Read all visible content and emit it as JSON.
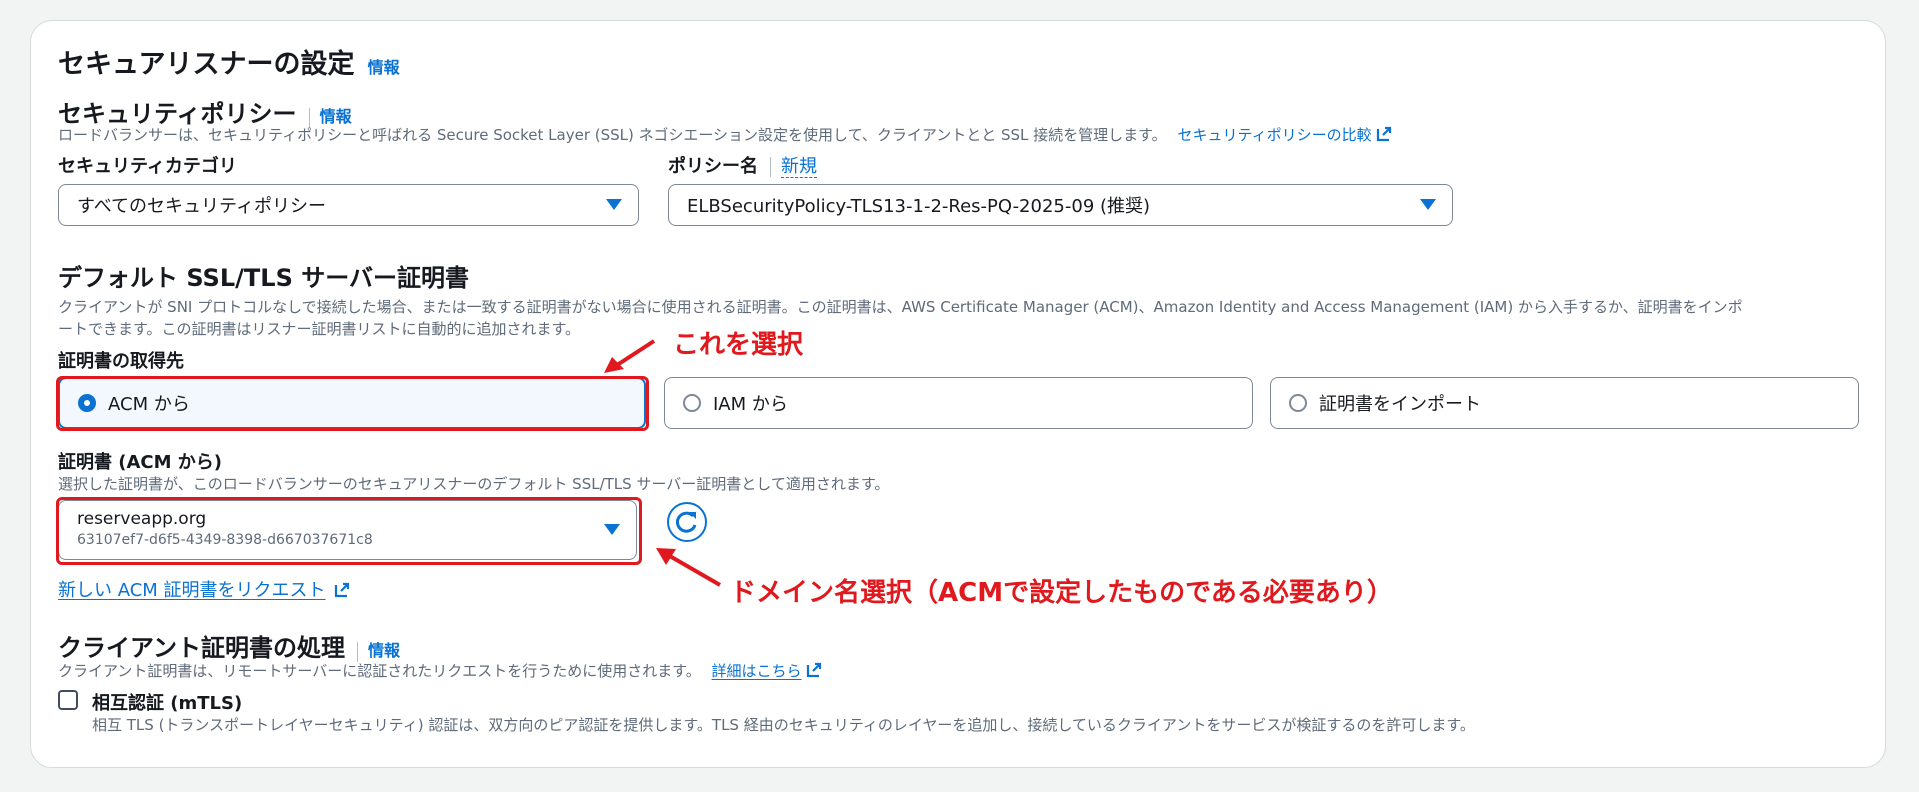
{
  "secure_listener": {
    "title": "セキュアリスナーの設定",
    "info": "情報"
  },
  "security_policy": {
    "title": "セキュリティポリシー",
    "info": "情報",
    "description": "ロードバランサーは、セキュリティポリシーと呼ばれる Secure Socket Layer (SSL) ネゴシエーション設定を使用して、クライアントとと SSL 接続を管理します。",
    "compare_link": "セキュリティポリシーの比較",
    "category_label": "セキュリティカテゴリ",
    "category_value": "すべてのセキュリティポリシー",
    "policy_label": "ポリシー名",
    "policy_new": "新規",
    "policy_value": "ELBSecurityPolicy-TLS13-1-2-Res-PQ-2025-09 (推奨)"
  },
  "default_cert": {
    "title": "デフォルト SSL/TLS サーバー証明書",
    "desc_line1": "クライアントが SNI プロトコルなしで接続した場合、または一致する証明書がない場合に使用される証明書。この証明書は、AWS Certificate Manager (ACM)、Amazon Identity and Access Management (IAM) から入手するか、証明書をインポ",
    "desc_line2": "ートできます。この証明書はリスナー証明書リストに自動的に追加されます。",
    "source_label": "証明書の取得先",
    "options": [
      {
        "label": "ACM から",
        "selected": true
      },
      {
        "label": "IAM から",
        "selected": false
      },
      {
        "label": "証明書をインポート",
        "selected": false
      }
    ]
  },
  "cert_acm": {
    "label": "証明書 (ACM から)",
    "description": "選択した証明書が、このロードバランサーのセキュアリスナーのデフォルト SSL/TLS サーバー証明書として適用されます。",
    "domain": "reserveapp.org",
    "cert_id": "63107ef7-d6f5-4349-8398-d667037671c8",
    "request_link": "新しい ACM 証明書をリクエスト"
  },
  "client_cert": {
    "title": "クライアント証明書の処理",
    "info": "情報",
    "description": "クライアント証明書は、リモートサーバーに認証されたリクエストを行うために使用されます。",
    "details_link": "詳細はこちら",
    "mtls_label": "相互認証 (mTLS)",
    "mtls_checked": false,
    "mtls_description": "相互 TLS (トランスポートレイヤーセキュリティ) 認証は、双方向のピア認証を提供します。TLS 経由のセキュリティのレイヤーを追加し、接続しているクライアントをサービスが検証するのを許可します。"
  },
  "annotations": {
    "select_this": "これを選択",
    "domain_select": "ドメイン名選択（ACMで設定したものである必要あり）"
  },
  "colors": {
    "accent": "#0972d3",
    "annotation_red": "#e0191e"
  }
}
